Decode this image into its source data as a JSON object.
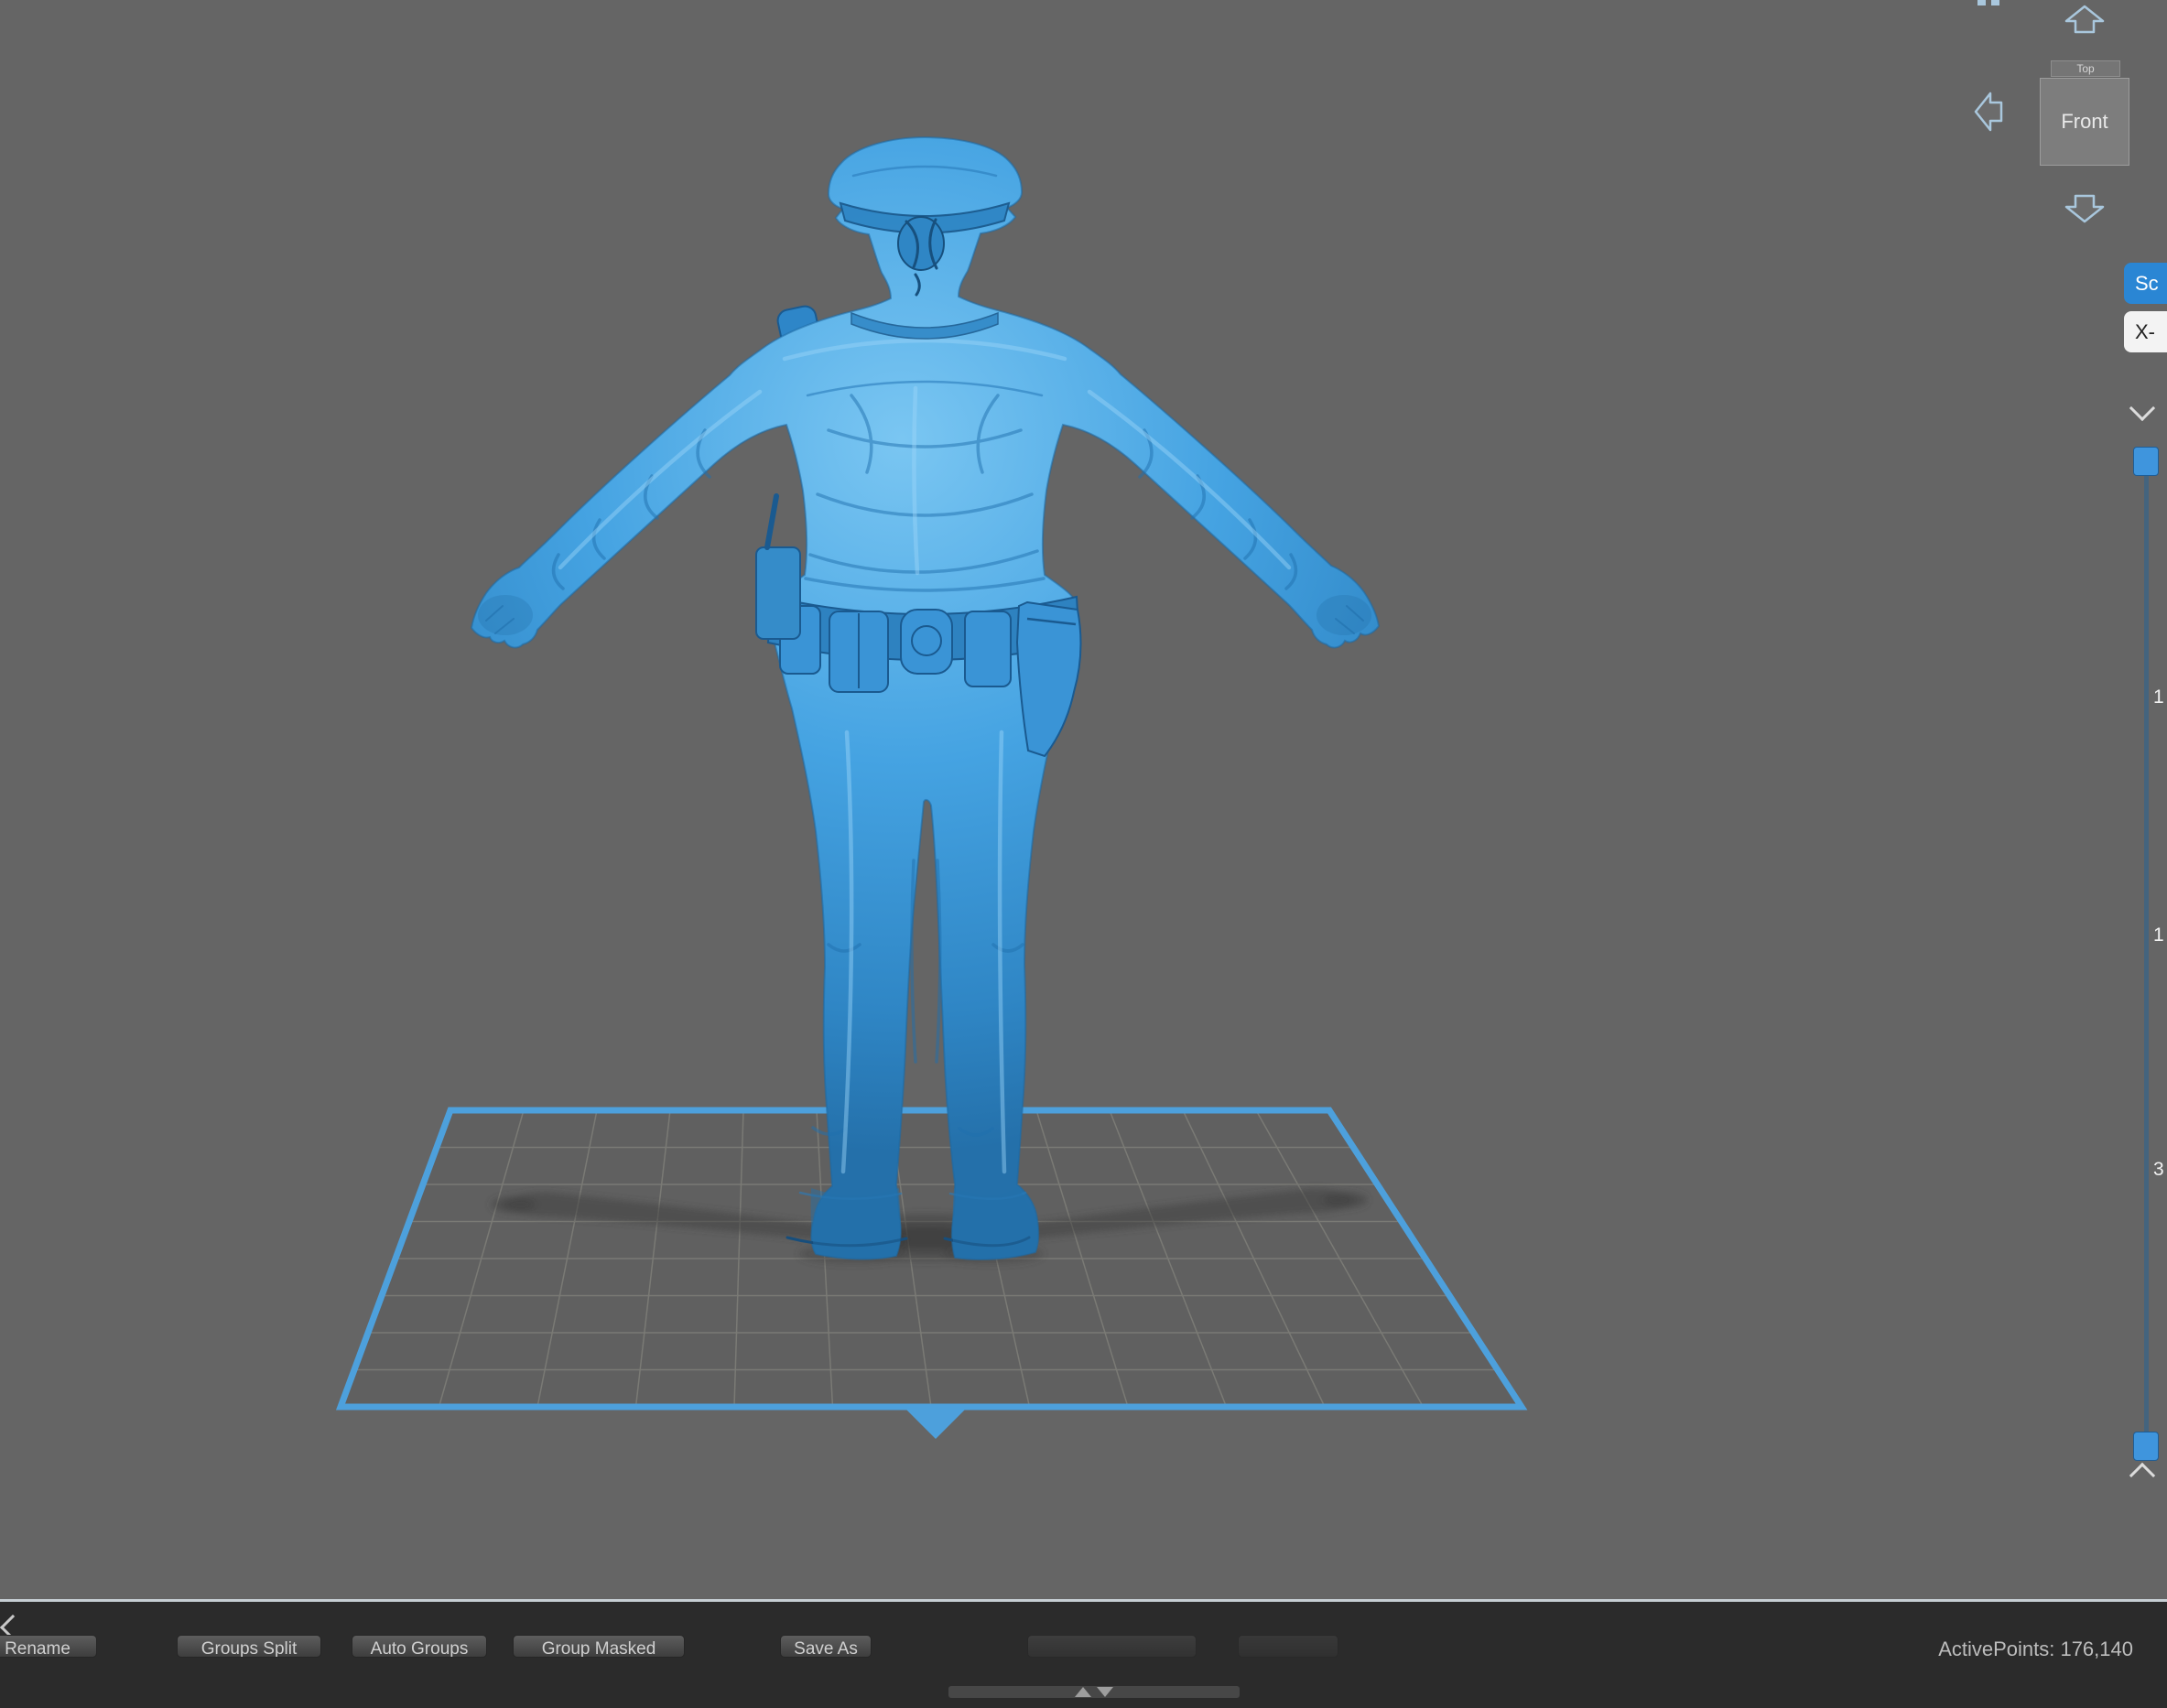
{
  "colors": {
    "viewport_bg": "#656565",
    "model_blue": "#45a3e2",
    "model_blue_dark": "#1f6fae",
    "model_blue_light": "#9bd4f8",
    "grid_blue": "#4da0dc",
    "accent_blue": "#2a86d4",
    "bottom_bar_bg": "#2b2b2b"
  },
  "viewport": {
    "model_label": "police-officer-sculpt-back-view-t-pose"
  },
  "nav_cube": {
    "top": "Top",
    "front": "Front"
  },
  "right_panel": {
    "scale_button": "Sc",
    "xray_button": "X-",
    "tick_labels": [
      "1",
      "1",
      "3"
    ]
  },
  "bottom_bar": {
    "buttons": [
      {
        "label": "Rename"
      },
      {
        "label": "Groups Split"
      },
      {
        "label": "Auto Groups"
      },
      {
        "label": "Group Masked"
      },
      {
        "label": "Save As"
      },
      {
        "label": ""
      },
      {
        "label": ""
      }
    ],
    "active_points": "ActivePoints: 176,140"
  }
}
